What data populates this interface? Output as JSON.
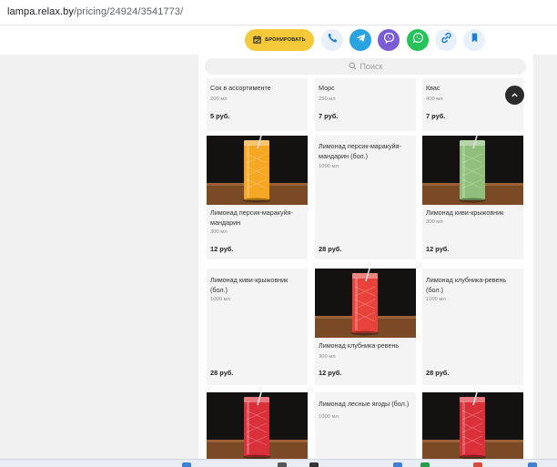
{
  "browser": {
    "url_host": "lampa.relax.by",
    "url_path": "/pricing/24924/3541773/"
  },
  "toolbar": {
    "book_label": "БРОНИРОВАТЬ",
    "icons": [
      "phone-icon",
      "telegram-icon",
      "viber-icon",
      "whatsapp-icon",
      "link-icon",
      "bookmark-icon"
    ],
    "colors": {
      "book": "#f6c93a",
      "phone_bg": "#e8f1fb",
      "telegram": "#2aa3e3",
      "viber": "#7b5cd6",
      "whatsapp": "#25c35a",
      "link_bg": "#e8f1fb",
      "bookmark_bg": "#e8f1fb",
      "accent_blue": "#1f7fd8"
    }
  },
  "search": {
    "placeholder": "Поиск"
  },
  "menu": {
    "items": [
      {
        "name": "Сок в ассортименте",
        "volume": "200 мл",
        "price": "5 руб.",
        "photo": false
      },
      {
        "name": "Морс",
        "volume": "250 мл",
        "price": "7 руб.",
        "photo": false
      },
      {
        "name": "Квас",
        "volume": "400 мл",
        "price": "7 руб.",
        "photo": false
      },
      {
        "name": "Лимонад персик-маракуйя-мандарин",
        "volume": "300 мл",
        "price": "12 руб.",
        "photo": true,
        "drink_color": "#f5a623"
      },
      {
        "name": "Лимонад персик-маракуйя-мандарин (бол.)",
        "volume": "1000 мл",
        "price": "28 руб.",
        "photo": false
      },
      {
        "name": "Лимонад киви-крыжовник",
        "volume": "300 мл",
        "price": "12 руб.",
        "photo": true,
        "drink_color": "#8fbf7a"
      },
      {
        "name": "Лимонад киви-крыжовник (бол.)",
        "volume": "1000 мл",
        "price": "28 руб.",
        "photo": false
      },
      {
        "name": "Лимонад клубника-ревень",
        "volume": "300 мл",
        "price": "12 руб.",
        "photo": true,
        "drink_color": "#e8433a"
      },
      {
        "name": "Лимонад клубника-ревень (бол.)",
        "volume": "1000 мл",
        "price": "28 руб.",
        "photo": false
      },
      {
        "name": "",
        "volume": "",
        "price": "",
        "photo": true,
        "drink_color": "#d9303a"
      },
      {
        "name": "Лимонад лесные ягоды (бол.)",
        "volume": "1000 мл",
        "price": "",
        "photo": false
      },
      {
        "name": "",
        "volume": "",
        "price": "",
        "photo": true,
        "drink_color": "#d9303a"
      }
    ]
  }
}
